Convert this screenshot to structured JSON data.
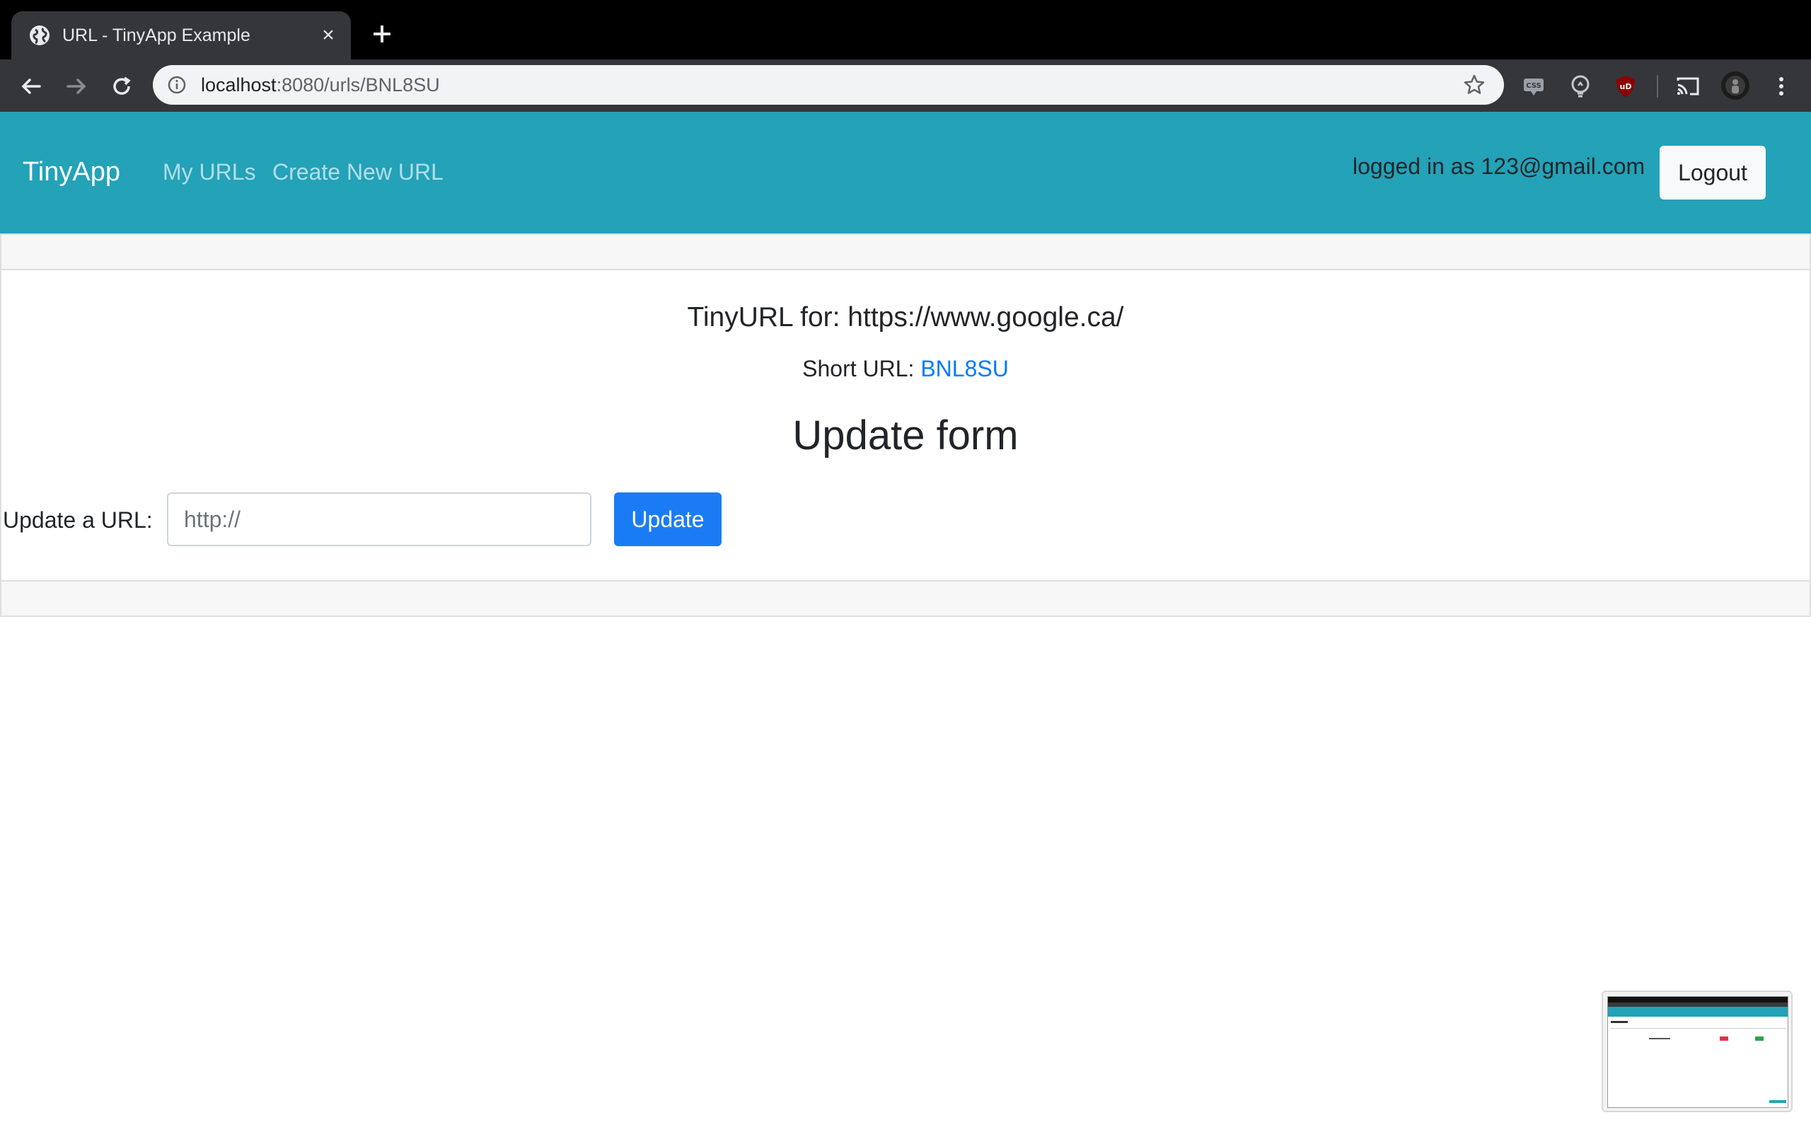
{
  "browser": {
    "tab_title": "URL - TinyApp Example",
    "url_host": "localhost",
    "url_rest": ":8080/urls/BNL8SU"
  },
  "navbar": {
    "brand": "TinyApp",
    "links": [
      "My URLs",
      "Create New URL"
    ],
    "login_text": "logged in as 123@gmail.com",
    "logout_label": "Logout"
  },
  "card": {
    "title": "TinyURL for: https://www.google.ca/",
    "short_label": "Short URL: ",
    "short_code": "BNL8SU",
    "form_title": "Update form",
    "form_label": "Update a URL:",
    "input_placeholder": "http://",
    "update_label": "Update"
  },
  "colors": {
    "navbar": "#23a2b8",
    "primary": "#1a7cf5",
    "link": "#007bff"
  }
}
